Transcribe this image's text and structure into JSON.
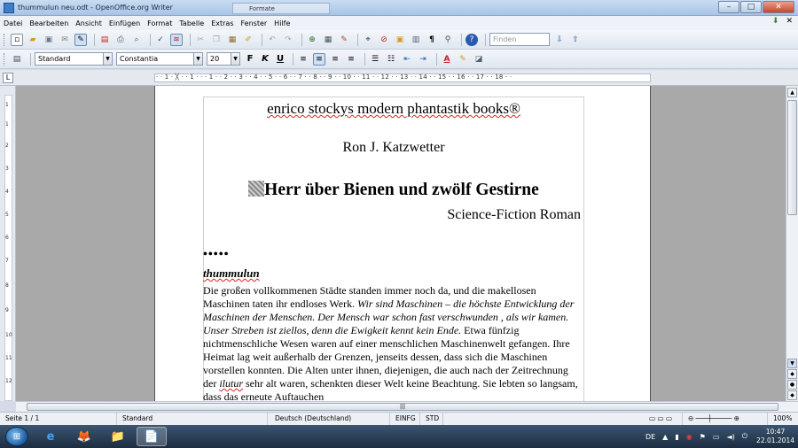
{
  "window": {
    "title": "thummulun neu.odt - OpenOffice.org Writer",
    "ghost_tab": "Formate",
    "controls": {
      "minimize": "–",
      "maximize": "□",
      "close": "✕"
    }
  },
  "menu": {
    "items": [
      "Datei",
      "Bearbeiten",
      "Ansicht",
      "Einfügen",
      "Format",
      "Tabelle",
      "Extras",
      "Fenster",
      "Hilfe"
    ],
    "right_icons": [
      "download-icon",
      "close-document-icon"
    ],
    "close_glyph": "✕",
    "download_glyph": "⬇"
  },
  "toolbar_standard": {
    "find_placeholder": "Finden"
  },
  "toolbar_format": {
    "paragraph_style": "Standard",
    "font_name": "Constantia",
    "font_size": "20",
    "bold": "F",
    "italic": "K",
    "underline": "U"
  },
  "ruler": {
    "corner_glyph": "L",
    "ticks": "· · 1 · ╳ · · 1 · · · 1 · · 2 · · 3 · · 4 · · 5 · · 6 · · 7 · · 8 · · 9 · · 10 · · 11 · · 12 · · 13 · · 14 · · 15 · · 16 · · 17 · · 18 · ·",
    "vertical_ticks": [
      "1",
      "1",
      "2",
      "3",
      "4",
      "5",
      "6",
      "7",
      "8",
      "9",
      "10",
      "11",
      "12"
    ]
  },
  "document": {
    "publisher": "enrico stockys modern phantastik books®",
    "author": "Ron J. Katzwetter",
    "title": "Herr über Bienen und zwölf Gestirne",
    "genre": "Science-Fiction Roman",
    "bullets": "•••••",
    "chapter": "thummulun",
    "para1": " Die großen vollkommenen Städte standen immer noch da, und die makellosen Maschinen taten ihr endloses Werk. ",
    "para1_italic": "Wir sind Maschinen – die höchste Entwicklung der Maschinen der Menschen. Der Mensch war schon fast verschwunden , als wir kamen. Unser Streben ist ziellos, denn die Ewigkeit kennt kein Ende.",
    "para2": " Etwa fünfzig nichtmenschliche Wesen waren auf einer menschlichen Maschinenwelt gefangen. Ihre Heimat lag weit außerhalb der Grenzen, jenseits dessen, dass sich die Maschinen vorstellen konnten. Die Alten unter ihnen, diejenigen, die auch nach der Zeitrechnung der ",
    "para2_word": "ilutur",
    "para2_end": " sehr alt waren, schenkten dieser Welt keine Beachtung. Sie lebten so langsam, dass das erneute Auftauchen"
  },
  "statusbar": {
    "page": "Seite 1 / 1",
    "style": "Standard",
    "language": "Deutsch (Deutschland)",
    "insert_mode": "EINFG",
    "selection_mode": "STD",
    "zoom": "100%"
  },
  "taskbar": {
    "start_glyph": "⊞",
    "tasks": [
      {
        "name": "taskbar-ie",
        "glyph": "e"
      },
      {
        "name": "taskbar-firefox",
        "glyph": "🦊"
      },
      {
        "name": "taskbar-explorer",
        "glyph": "📁"
      },
      {
        "name": "taskbar-writer",
        "glyph": "📄"
      }
    ],
    "tray_lang": "DE",
    "time": "10:47",
    "date": "22.01.2014"
  }
}
